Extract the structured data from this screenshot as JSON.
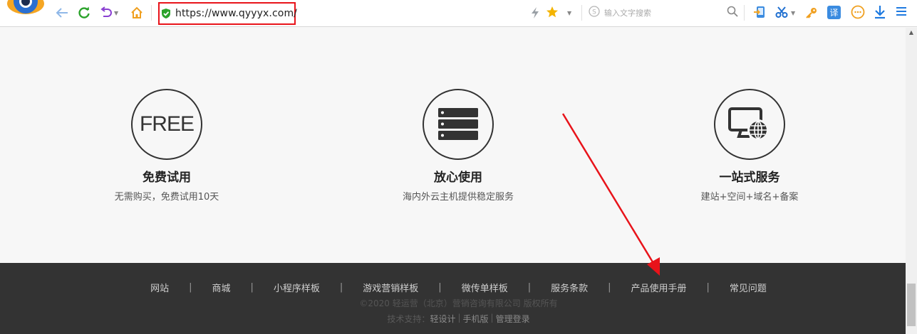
{
  "browser": {
    "url": "https://www.qyyyx.com/",
    "search_placeholder": "输入文字搜索",
    "translate_label": "译"
  },
  "features": [
    {
      "icon_text": "FREE",
      "title": "免费试用",
      "desc": "无需购买，免费试用10天"
    },
    {
      "title": "放心使用",
      "desc": "海内外云主机提供稳定服务"
    },
    {
      "title": "一站式服务",
      "desc": "建站+空间+域名+备案"
    }
  ],
  "footer": {
    "nav": [
      "网站",
      "商城",
      "小程序样板",
      "游戏营销样板",
      "微传单样板",
      "服务条款",
      "产品使用手册",
      "常见问题"
    ],
    "separator": "|",
    "copyright": "©2020 轻运营（北京）营销咨询有限公司 版权所有",
    "support_label": "技术支持：",
    "support_links": [
      "轻设计",
      "手机版",
      "管理登录"
    ]
  },
  "colors": {
    "accent_red": "#e8131a",
    "footer_bg": "#333333",
    "content_bg": "#f7f7f7"
  }
}
